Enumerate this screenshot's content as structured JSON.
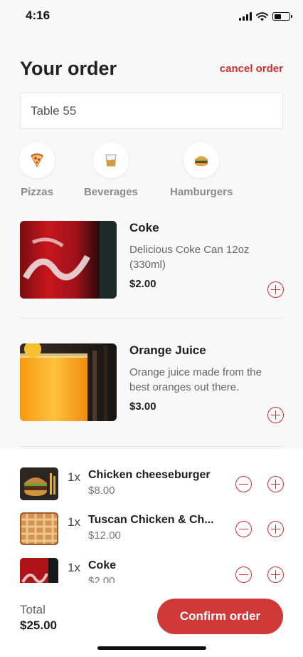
{
  "status_bar": {
    "time": "4:16"
  },
  "header": {
    "title": "Your order",
    "cancel_label": "cancel order"
  },
  "table_field": {
    "value": "Table 55",
    "placeholder": "Table number"
  },
  "categories": [
    {
      "label": "Pizzas",
      "icon": "pizza-icon"
    },
    {
      "label": "Beverages",
      "icon": "beverage-glass-icon"
    },
    {
      "label": "Hamburgers",
      "icon": "hamburger-icon"
    }
  ],
  "menu_items": [
    {
      "name": "Coke",
      "description": "Delicious Coke Can 12oz (330ml)",
      "price": "$2.00",
      "image": "coke-can-photo"
    },
    {
      "name": "Orange Juice",
      "description": "Orange juice made from the best oranges out there.",
      "price": "$3.00",
      "image": "orange-juice-photo"
    }
  ],
  "cart": [
    {
      "qty": "1x",
      "name": "Chicken cheeseburger",
      "price": "$8.00",
      "image": "burger-photo"
    },
    {
      "qty": "1x",
      "name": "Tuscan Chicken & Ch...",
      "price": "$12.00",
      "image": "pizza-photo"
    },
    {
      "qty": "1x",
      "name": "Coke",
      "price": "$2.00",
      "image": "coke-can-photo"
    }
  ],
  "footer": {
    "total_label": "Total",
    "total_value": "$25.00",
    "confirm_label": "Confirm order"
  },
  "colors": {
    "accent": "#c8302f",
    "button": "#cf3a38",
    "background": "#f8f8f8"
  }
}
